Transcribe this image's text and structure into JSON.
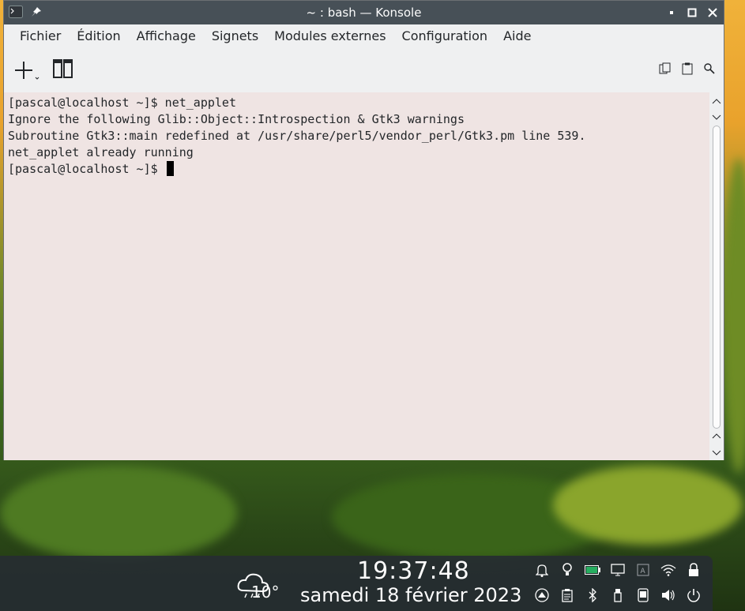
{
  "window": {
    "title": "~ : bash — Konsole"
  },
  "menubar": {
    "items": [
      "Fichier",
      "Édition",
      "Affichage",
      "Signets",
      "Modules externes",
      "Configuration",
      "Aide"
    ]
  },
  "terminal": {
    "lines": [
      "[pascal@localhost ~]$ net_applet",
      "Ignore the following Glib::Object::Introspection & Gtk3 warnings",
      "Subroutine Gtk3::main redefined at /usr/share/perl5/vendor_perl/Gtk3.pm line 539.",
      "net_applet already running",
      "[pascal@localhost ~]$ "
    ]
  },
  "panel": {
    "time": "19:37:48",
    "date": "samedi 18 février 2023",
    "temperature": "10°"
  },
  "colors": {
    "titlebar": "#475057",
    "terminal_bg": "#efe4e3",
    "panel_bg": "#262c32"
  }
}
